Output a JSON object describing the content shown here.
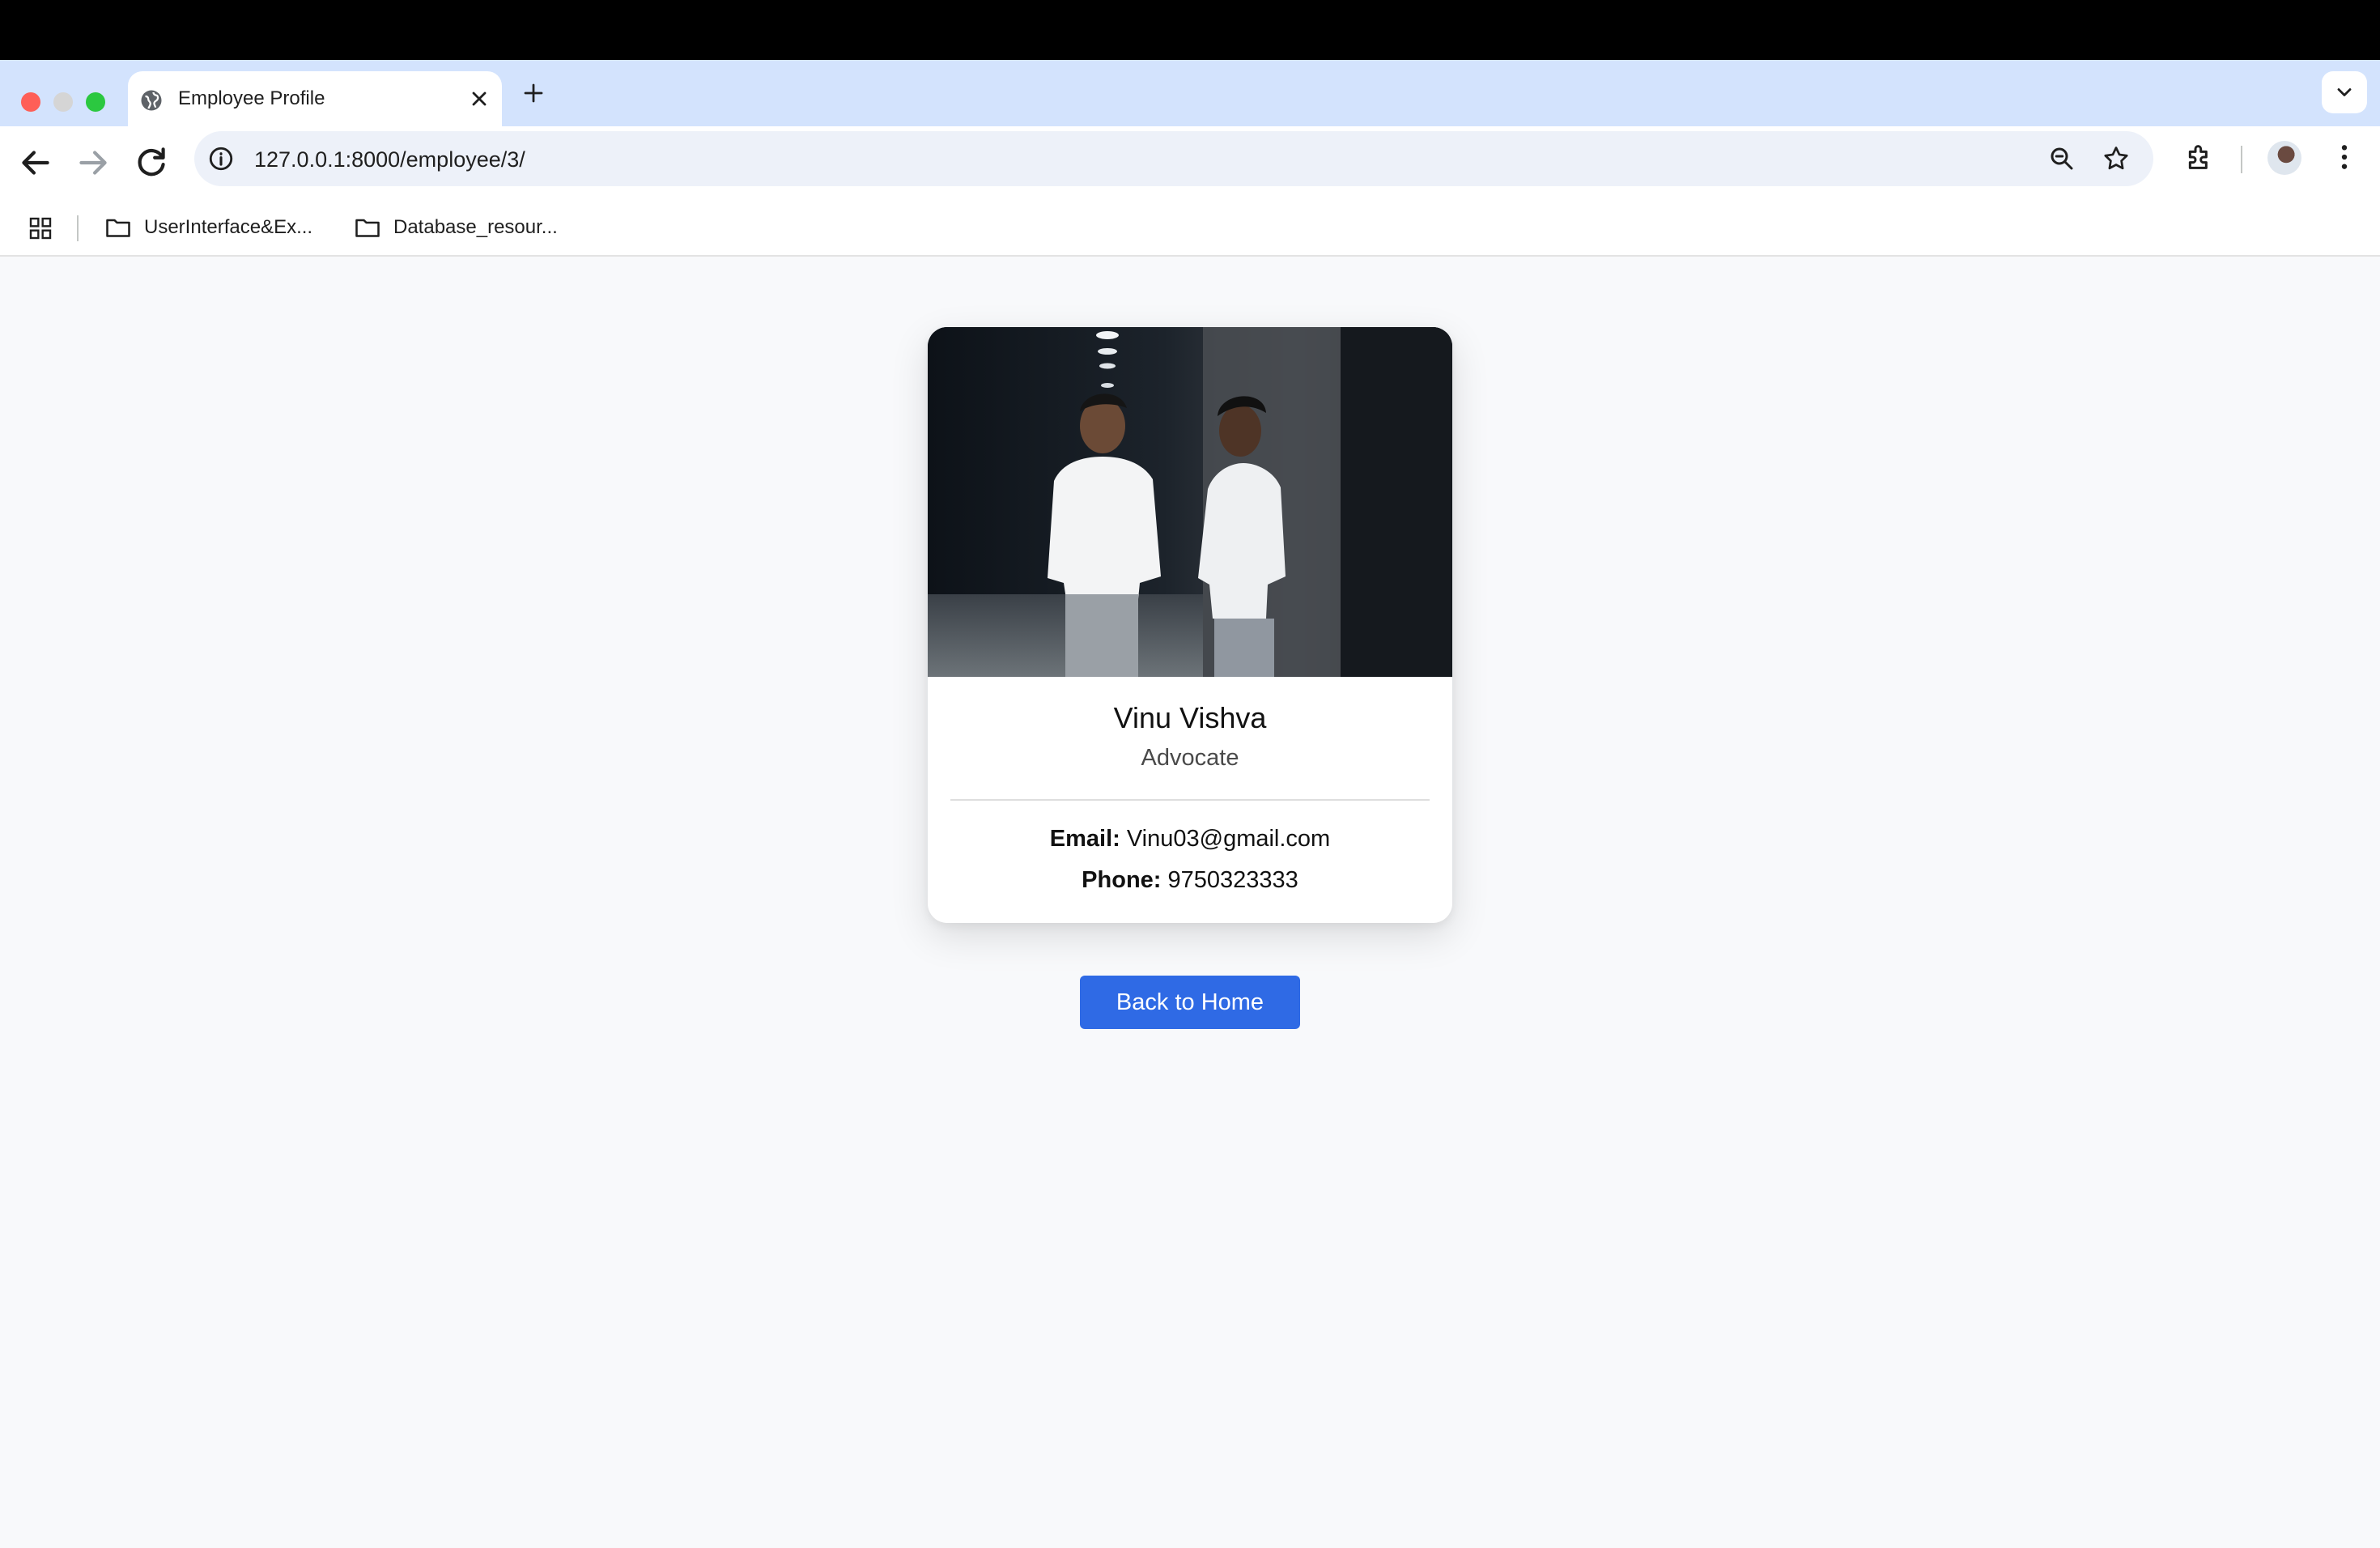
{
  "browser": {
    "tab": {
      "title": "Employee Profile"
    },
    "address_bar": {
      "url": "127.0.0.1:8000/employee/3/"
    },
    "bookmarks": [
      {
        "label": "UserInterface&Ex..."
      },
      {
        "label": "Database_resour..."
      }
    ],
    "icons": {
      "traffic_lights": [
        "close",
        "minimize",
        "maximize"
      ],
      "toolbar": [
        "back-icon",
        "forward-icon",
        "reload-icon",
        "site-info-icon",
        "zoom-icon",
        "bookmark-star-icon",
        "extensions-icon",
        "profile-avatar",
        "more-menu-icon"
      ]
    }
  },
  "profile": {
    "name": "Vinu Vishva",
    "role": "Advocate",
    "email_label": "Email:",
    "email": "Vinu03@gmail.com",
    "phone_label": "Phone:",
    "phone": "9750323333"
  },
  "actions": {
    "back_label": "Back to Home"
  },
  "colors": {
    "accent": "#2f6ae5",
    "page_background": "#f8f9fb",
    "tabstrip": "#d3e3fd",
    "omnibox": "#edf1f9"
  }
}
